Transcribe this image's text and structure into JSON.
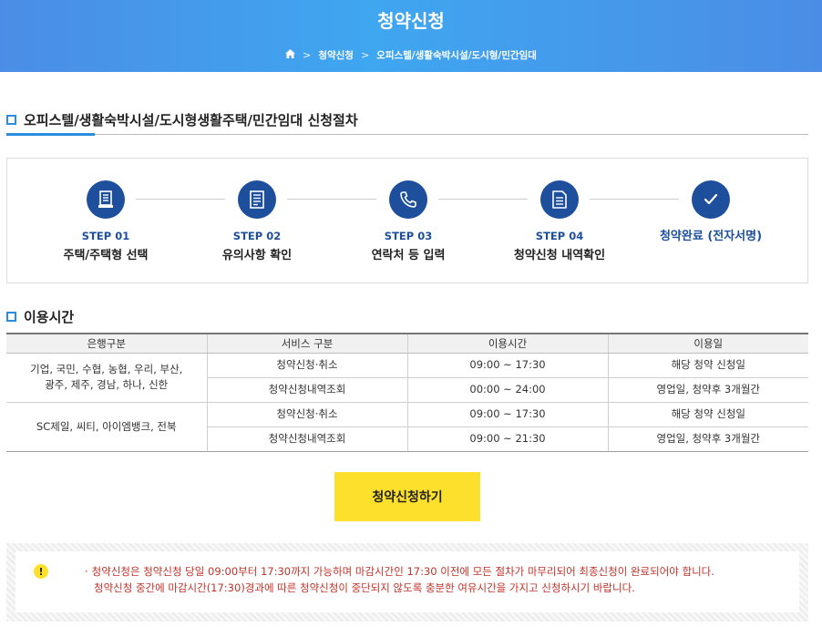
{
  "header": {
    "title": "청약신청",
    "breadcrumb": [
      "청약신청",
      "오피스텔/생활숙박시설/도시형/민간임대"
    ]
  },
  "procedure": {
    "heading": "오피스텔/생활숙박시설/도시형생활주택/민간임대 신청절차",
    "steps": [
      {
        "num": "STEP 01",
        "label": "주택/주택형 선택",
        "icon": "document-icon"
      },
      {
        "num": "STEP 02",
        "label": "유의사항 확인",
        "icon": "notice-list-icon"
      },
      {
        "num": "STEP 03",
        "label": "연락처 등 입력",
        "icon": "phone-icon"
      },
      {
        "num": "STEP 04",
        "label": "청약신청 내역확인",
        "icon": "checklist-document-icon"
      }
    ],
    "final_step": {
      "label": "청약완료 (전자서명)",
      "icon": "check-icon"
    }
  },
  "usage": {
    "heading": "이용시간",
    "columns": [
      "은행구분",
      "서비스 구분",
      "이용시간",
      "이용일"
    ],
    "groups": [
      {
        "bank": [
          "기업, 국민, 수협, 농협, 우리, 부산,",
          "광주, 제주, 경남, 하나, 신한"
        ],
        "rows": [
          {
            "service": "청약신청·취소",
            "time": "09:00 ~ 17:30",
            "day": "해당 청약 신청일"
          },
          {
            "service": "청약신청내역조회",
            "time": "00:00 ~ 24:00",
            "day": "영업일, 청약후 3개월간"
          }
        ]
      },
      {
        "bank": [
          "SC제일, 씨티, 아이엠뱅크, 전북"
        ],
        "rows": [
          {
            "service": "청약신청·취소",
            "time": "09:00 ~ 17:30",
            "day": "해당 청약 신청일"
          },
          {
            "service": "청약신청내역조회",
            "time": "09:00 ~ 21:30",
            "day": "영업일, 청약후 3개월간"
          }
        ]
      }
    ]
  },
  "apply_button": "청약신청하기",
  "notice": {
    "bullet": "·",
    "line1": "청약신청은 청약신청 당일 09:00부터 17:30까지 가능하며 마감시간인 17:30 이전에 모든 절차가 마무리되어 최종신청이 완료되어야 합니다.",
    "line2": "청약신청 중간에 마감시간(17:30)경과에 따른 청약신청이 중단되지 않도록 충분한 여유시간을 가지고 신청하시기 바랍니다.",
    "icon": "warning-icon"
  },
  "colors": {
    "banner": "#3fa6f0",
    "step_circle": "#1d4f9c",
    "accent": "#2b8de0",
    "button": "#fde02c",
    "notice_text": "#c0332a"
  }
}
